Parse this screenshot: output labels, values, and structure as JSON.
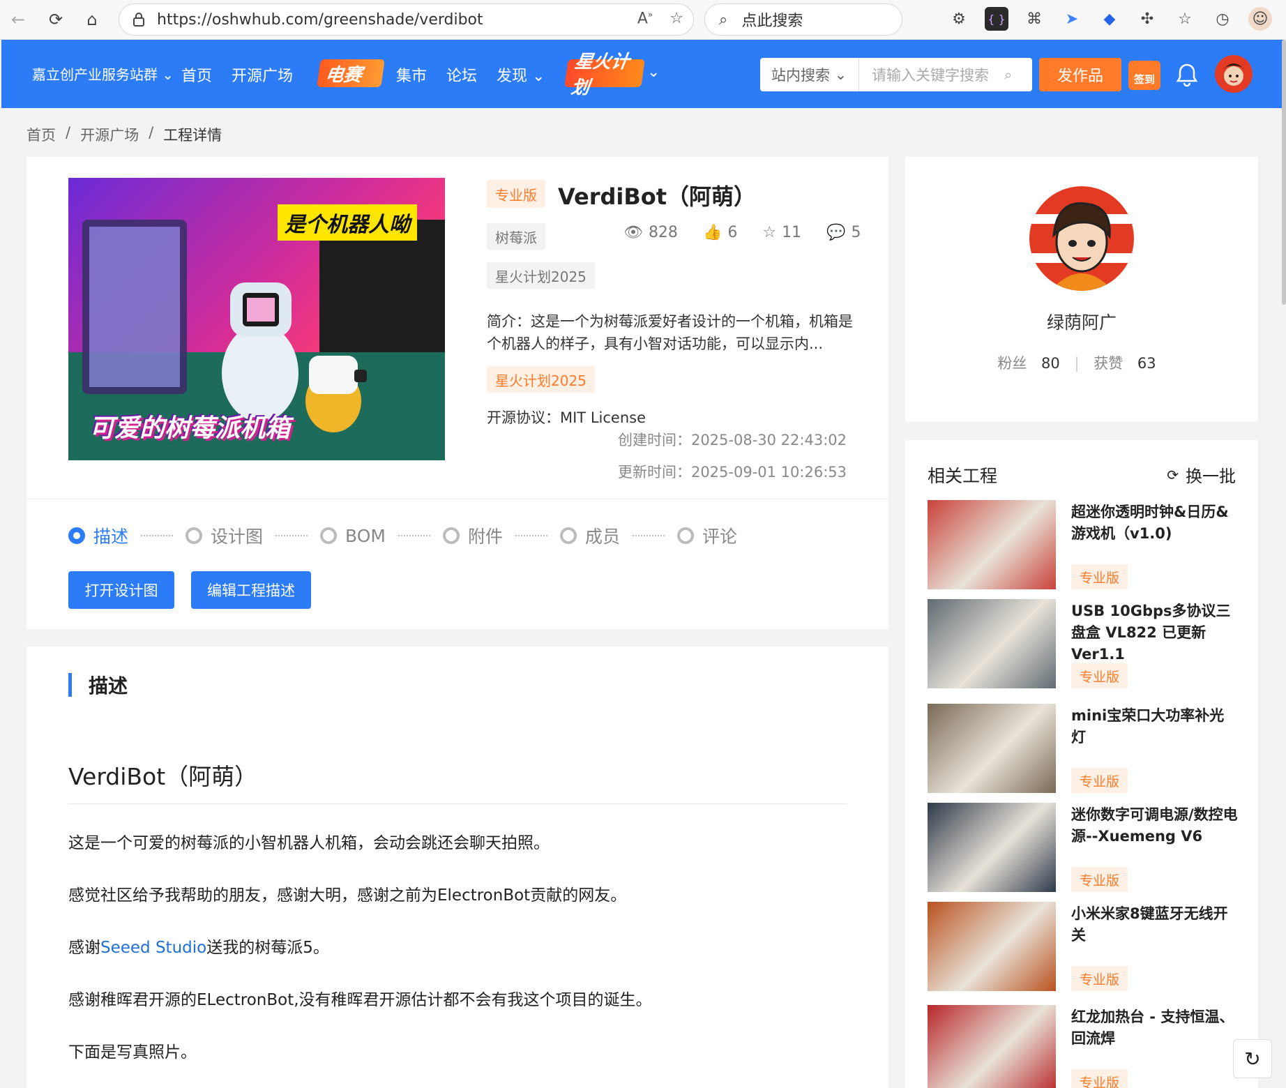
{
  "browser": {
    "url": "https://oshwhub.com/greenshade/verdibot",
    "search_placeholder": "点此搜索"
  },
  "header": {
    "site_selector": "嘉立创产业服务站群",
    "nav": [
      "首页",
      "开源广场",
      "集市",
      "论坛",
      "发现"
    ],
    "logo_dian": "电赛",
    "logo_xing": "星火计划",
    "search_scope": "站内搜索",
    "search_placeholder": "请输入关键字搜索",
    "publish": "发作品",
    "signin": "签到"
  },
  "breadcrumb": [
    "首页",
    "开源广场",
    "工程详情"
  ],
  "project": {
    "cover_top_text": "是个机器人呦",
    "cover_bottom_text": "可爱的树莓派机箱",
    "edition": "专业版",
    "title": "VerdiBot（阿萌）",
    "category": "树莓派",
    "event_tag": "星火计划2025",
    "views": "828",
    "likes": "6",
    "stars": "11",
    "comments": "5",
    "intro": "简介：这是一个为树莓派爱好者设计的一个机箱，机箱是个机器人的样子，具有小智对话功能，可以显示内...",
    "event_tag_orange": "星火计划2025",
    "license": "开源协议：MIT License",
    "created": "创建时间：2025-08-30 22:43:02",
    "updated": "更新时间：2025-09-01 10:26:53"
  },
  "steps": [
    "描述",
    "设计图",
    "BOM",
    "附件",
    "成员",
    "评论"
  ],
  "buttons": {
    "open_design": "打开设计图",
    "edit_desc": "编辑工程描述"
  },
  "description": {
    "heading": "描述",
    "title": "VerdiBot（阿萌）",
    "p1": "这是一个可爱的树莓派的小智机器人机箱，会动会跳还会聊天拍照。",
    "p2": "感觉社区给予我帮助的朋友，感谢大明，感谢之前为ElectronBot贡献的网友。",
    "p3_prefix": "感谢",
    "p3_link": "Seeed Studio",
    "p3_suffix": "送我的树莓派5。",
    "p4": "感谢稚晖君开源的ELectronBot,没有稚晖君开源估计都不会有我这个项目的诞生。",
    "p5": "下面是写真照片。"
  },
  "author": {
    "name": "绿荫阿广",
    "fans_label": "粉丝",
    "fans": "80",
    "likes_label": "获赞",
    "likes": "63"
  },
  "related": {
    "title": "相关工程",
    "refresh": "换一批",
    "items": [
      {
        "name": "超迷你透明时钟&日历&游戏机（v1.0)",
        "badge": "专业版",
        "color": "#c9423a"
      },
      {
        "name": "USB 10Gbps多协议三盘盒 VL822 已更新Ver1.1",
        "badge": "专业版",
        "color": "#5f6b73"
      },
      {
        "name": "mini宝荣口大功率补光灯",
        "badge": "专业版",
        "color": "#7a6a55"
      },
      {
        "name": "迷你数字可调电源/数控电源--Xuemeng V6",
        "badge": "专业版",
        "color": "#2e3a4a"
      },
      {
        "name": "小米米家8键蓝牙无线开关",
        "badge": "专业版",
        "color": "#b9521f"
      },
      {
        "name": "红龙加热台 - 支持恒温、回流焊",
        "badge": "专业版",
        "color": "#b8272a"
      }
    ]
  },
  "colors": {
    "brand_blue": "#2d7cf7",
    "accent_orange": "#ff7b29"
  }
}
